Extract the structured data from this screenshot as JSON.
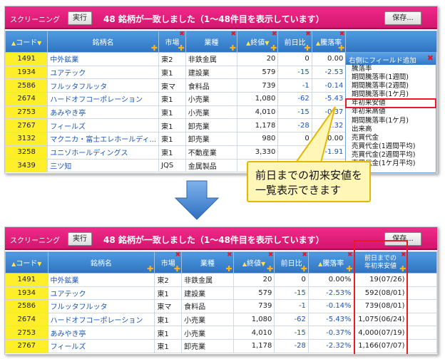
{
  "top": {
    "toolbar": {
      "label": "スクリーニング",
      "run_label": "実行",
      "count_text": "48 銘柄が一致しました（1～48件目を表示しています）",
      "save_label": "保存..."
    },
    "headers": {
      "code": "コード",
      "name": "銘柄名",
      "market": "市場",
      "industry": "業種",
      "close": "終値",
      "prev_diff": "前日比",
      "change_rate": "騰落率"
    },
    "rows": [
      {
        "code": "1491",
        "name": "中外鉱業",
        "market": "東2",
        "industry": "非鉄金属",
        "close": "20",
        "diff": "0",
        "rate": "0.00"
      },
      {
        "code": "1934",
        "name": "ユアテック",
        "market": "東1",
        "industry": "建設業",
        "close": "579",
        "diff": "-15",
        "rate": "-2.53"
      },
      {
        "code": "2586",
        "name": "フルッタフルッタ",
        "market": "東マ",
        "industry": "食料品",
        "close": "739",
        "diff": "-1",
        "rate": "-0.14"
      },
      {
        "code": "2674",
        "name": "ハードオフコーポレーション",
        "market": "東1",
        "industry": "小売業",
        "close": "1,080",
        "diff": "-62",
        "rate": "-5.43"
      },
      {
        "code": "2753",
        "name": "あみやき亭",
        "market": "東1",
        "industry": "小売業",
        "close": "4,010",
        "diff": "-15",
        "rate": "-0.37"
      },
      {
        "code": "2767",
        "name": "フィールズ",
        "market": "東1",
        "industry": "卸売業",
        "close": "1,178",
        "diff": "-28",
        "rate": "-2.32"
      },
      {
        "code": "3132",
        "name": "マクニカ・富士エレホールディ...",
        "market": "東1",
        "industry": "卸売業",
        "close": "980",
        "diff": "0",
        "rate": "0.00"
      },
      {
        "code": "3258",
        "name": "ユニゾホールディングス",
        "market": "東1",
        "industry": "不動産業",
        "close": "3,330",
        "diff": "-6",
        "rate": "-1.91"
      },
      {
        "code": "3439",
        "name": "三ツ知",
        "market": "JQS",
        "industry": "金属製品",
        "close": "",
        "diff": "",
        "rate": ""
      }
    ],
    "popup": {
      "title": "右側にフィールド追加",
      "items": [
        "騰落率",
        "期間騰落率(1週間)",
        "期間騰落率(2週間)",
        "期間騰落率(1ケ月)",
        "年初来安値",
        "年初来高値",
        "期間騰落率(1ケ月)",
        "出来高",
        "売買代金",
        "売買代金(1週間平均)",
        "売買代金(2週間平均)",
        "売買代金(1ケ月平均)"
      ],
      "selected_index": 4
    },
    "callout": {
      "line1": "前日までの初来安値を",
      "line2": "一覧表示できます"
    }
  },
  "bottom": {
    "toolbar": {
      "label": "スクリーニング",
      "run_label": "実行",
      "count_text": "48 銘柄が一致しました（1～48件目を表示しています）",
      "save_label": "保存..."
    },
    "headers": {
      "code": "コード",
      "name": "銘柄名",
      "market": "市場",
      "industry": "業種",
      "close": "終値",
      "prev_diff": "前日比",
      "change_rate": "騰落率",
      "new_field_line1": "前日までの",
      "new_field_line2": "年初来安値"
    },
    "rows": [
      {
        "code": "1491",
        "name": "中外鉱業",
        "market": "東2",
        "industry": "非鉄金属",
        "close": "20",
        "diff": "0",
        "rate": "0.00%",
        "low": "19(07/26)"
      },
      {
        "code": "1934",
        "name": "ユアテック",
        "market": "東1",
        "industry": "建設業",
        "close": "579",
        "diff": "-15",
        "rate": "-2.53%",
        "low": "592(08/01)"
      },
      {
        "code": "2586",
        "name": "フルッタフルッタ",
        "market": "東マ",
        "industry": "食料品",
        "close": "739",
        "diff": "-1",
        "rate": "-0.14%",
        "low": "739(08/01)"
      },
      {
        "code": "2674",
        "name": "ハードオフコーポレーション",
        "market": "東1",
        "industry": "小売業",
        "close": "1,080",
        "diff": "-62",
        "rate": "-5.43%",
        "low": "1,075(06/24)"
      },
      {
        "code": "2753",
        "name": "あみやき亭",
        "market": "東1",
        "industry": "小売業",
        "close": "4,010",
        "diff": "-15",
        "rate": "-0.37%",
        "low": "4,000(07/19)"
      },
      {
        "code": "2767",
        "name": "フィールズ",
        "market": "東1",
        "industry": "卸売業",
        "close": "1,178",
        "diff": "-28",
        "rate": "-2.32%",
        "low": "1,166(07/07)"
      }
    ]
  },
  "colors": {
    "toolbar_pink": "#e01b7b",
    "header_blue": "#3a82d0",
    "code_yellow": "#ffef2a",
    "link_blue": "#1a56b8",
    "highlight_red": "#e81b25",
    "callout_yellow": "#fff6b8",
    "arrow_blue": "#2f6fc2"
  }
}
